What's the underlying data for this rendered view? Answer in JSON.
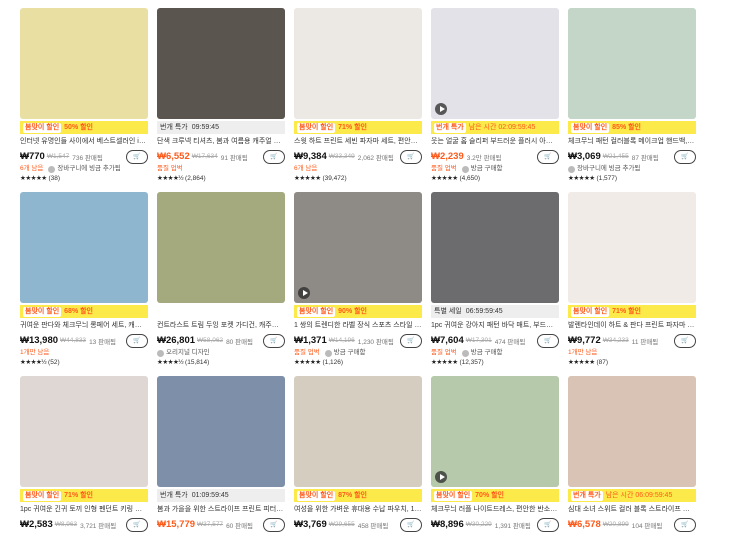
{
  "products": [
    {
      "image": "Yellow phone case",
      "bg": "#e9dfa3",
      "promo": {
        "style": "yellow",
        "tag": "봄맞이 할인",
        "discount": "50% 할인"
      },
      "title": "인터넷 유명인들 사이에서 베스트셀러인 iPh…",
      "price": "₩770",
      "orig": "₩1,547",
      "sold": "736 판매됨",
      "badge": "6개 남음",
      "seller": "장바구니에 빙금 추가됨",
      "rating": "(38)",
      "stars": "★★★★★",
      "hot": false,
      "video": false
    },
    {
      "image": "Girl in white t-shirt mirror selfie",
      "bg": "#5b5550",
      "promo": {
        "style": "gray",
        "label": "번개 특가",
        "timer": "09:59:45",
        "red": false
      },
      "title": "단색 크루넥 티셔츠, 봄과 여름용 캐주얼 반…",
      "price": "₩6,552",
      "orig": "₩17,634",
      "sold": "91 판매됨",
      "badge": "품질 업벅",
      "seller": "",
      "rating": "(2,864)",
      "stars": "★★★★½",
      "hot": true,
      "video": false
    },
    {
      "image": "Polka dot pajama set",
      "bg": "#ece9e4",
      "promo": {
        "style": "yellow",
        "tag": "봄맞이 할인",
        "discount": "71% 할인"
      },
      "title": "스윗 하트 프린트 세빈 파자마 세트, 편안한 …",
      "price": "₩9,384",
      "orig": "₩33,349",
      "sold": "2,062 판매됨",
      "badge": "6개 남음",
      "seller": "",
      "rating": "(39,472)",
      "stars": "★★★★★",
      "hot": false,
      "video": false
    },
    {
      "image": "Smiley slippers",
      "bg": "#e2e2e8",
      "promo": {
        "style": "yellow",
        "tag": "번개 특가",
        "timer": "남은 시간 02:09:59:45",
        "red": true
      },
      "title": "웃는 얼굴 홈 슬리퍼 부드러운 플러시 아늑한 …",
      "price": "₩2,239",
      "orig": "",
      "sold": "3.2만 판매됨",
      "badge": "품질 업벅",
      "seller": "방금 구매함",
      "rating": "(4,650)",
      "stars": "★★★★★",
      "hot": true,
      "video": true
    },
    {
      "image": "Pink plaid makeup bag",
      "bg": "#c3d6c8",
      "promo": {
        "style": "yellow",
        "tag": "봄맞이 할인",
        "discount": "85% 할인"
      },
      "title": "체크무늬 패턴 컬러블록 메이크업 핸드백, 지…",
      "price": "₩3,069",
      "orig": "₩21,455",
      "sold": "87 판매됨",
      "badge": "",
      "seller": "장바구니에 빙금 추가됨",
      "rating": "(1,577)",
      "stars": "★★★★★",
      "hot": false,
      "video": false
    },
    {
      "image": "Striped pajama cardigan",
      "bg": "#8fb6cf",
      "promo": {
        "style": "yellow",
        "tag": "봄맞이 할인",
        "discount": "68% 할인"
      },
      "title": "귀여운 판다와 체크무늬 롱페어 세트, 캐주얼…",
      "price": "₩13,980",
      "orig": "₩44,833",
      "sold": "13 판매됨",
      "badge": "1개만 남음",
      "seller": "",
      "rating": "(52)",
      "stars": "★★★★½",
      "hot": false,
      "video": false
    },
    {
      "image": "Green knit cardigan",
      "bg": "#a4aa7e",
      "promo": {
        "style": "none"
      },
      "title": "컨트라스트 트림 두잉 포켓 가디건, 캐주얼 롱…",
      "price": "₩26,801",
      "orig": "₩58,062",
      "sold": "80 판매됨",
      "badge": "",
      "seller": "오리지널 디자인",
      "rating": "(15,814)",
      "stars": "★★★★½",
      "hot": false,
      "video": false
    },
    {
      "image": "Green bear socks",
      "bg": "#8e8a86",
      "promo": {
        "style": "yellow",
        "tag": "봄맞이 할인",
        "discount": "90% 할인"
      },
      "title": "1 쌍의 트렌디한 라벨 장식 스포츠 스타일 …",
      "price": "₩1,371",
      "orig": "₩14,196",
      "sold": "1,230 판매됨",
      "badge": "품질 업벅",
      "seller": "방금 구매함",
      "rating": "(1,126)",
      "stars": "★★★★★",
      "hot": false,
      "video": true
    },
    {
      "image": "Dog bath mat",
      "bg": "#6c6c6f",
      "promo": {
        "style": "gray",
        "label": "특별 세일",
        "timer": "06:59:59:45",
        "red": false
      },
      "title": "1pc 귀여운 강아지 패턴 바닥 매트, 부드러운…",
      "price": "₩7,604",
      "orig": "₩17,301",
      "sold": "474 판매됨",
      "badge": "품질 업벅",
      "seller": "방금 구매함",
      "rating": "(12,357)",
      "stars": "★★★★★",
      "hot": false,
      "video": false
    },
    {
      "image": "Heart print pajama",
      "bg": "#f0ebe6",
      "promo": {
        "style": "yellow",
        "tag": "봄맞이 할인",
        "discount": "71% 할인"
      },
      "title": "발렌타인데이 하트 & 판다 프린트 파자마 세…",
      "price": "₩9,772",
      "orig": "₩34,233",
      "sold": "11 판매됨",
      "badge": "1개만 남음",
      "seller": "",
      "rating": "(87)",
      "stars": "★★★★★",
      "hot": false,
      "video": false
    },
    {
      "image": "Plush bunny doll",
      "bg": "#dfd7d3",
      "promo": {
        "style": "yellow",
        "tag": "봄맞이 할인",
        "discount": "71% 할인"
      },
      "title": "1pc 귀여운 긴귀 토끼 인형 펜던트 키링 소녀…",
      "price": "₩2,583",
      "orig": "₩8,963",
      "sold": "3,721 판매됨",
      "badge": "",
      "seller": "",
      "rating": "",
      "stars": "",
      "hot": false,
      "video": false
    },
    {
      "image": "Blue collar blouse",
      "bg": "#7e8faa",
      "promo": {
        "style": "gray",
        "label": "번개 특가",
        "timer": "01:09:59:45",
        "red": false
      },
      "title": "봄과 가을을 위한 스트라이프 프린트 피터팬 …",
      "price": "₩15,779",
      "orig": "₩37,577",
      "sold": "60 판매됨",
      "badge": "",
      "seller": "",
      "rating": "",
      "stars": "",
      "hot": true,
      "video": false
    },
    {
      "image": "Teddy bear seat cushion",
      "bg": "#d6cdc1",
      "promo": {
        "style": "yellow",
        "tag": "봄맞이 할인",
        "discount": "87% 할인"
      },
      "title": "여성을 위한 가벼운 휴대용 수납 파우치, 1개…",
      "price": "₩3,769",
      "orig": "₩29,655",
      "sold": "458 판매됨",
      "badge": "",
      "seller": "",
      "rating": "",
      "stars": "",
      "hot": false,
      "video": false
    },
    {
      "image": "Green gingham dress",
      "bg": "#b6c9aa",
      "promo": {
        "style": "yellow",
        "tag": "봄맞이 할인",
        "discount": "70% 할인"
      },
      "title": "체크무늬 러플 나이트드레스, 편안한 반소매 …",
      "price": "₩8,896",
      "orig": "₩30,229",
      "sold": "1,391 판매됨",
      "badge": "",
      "seller": "",
      "rating": "",
      "stars": "",
      "hot": false,
      "video": true
    },
    {
      "image": "Red striped knit top",
      "bg": "#d9c3b4",
      "promo": {
        "style": "yellow",
        "tag": "번개 특가",
        "timer": "남은 시간 06:09:59:45",
        "red": true
      },
      "title": "심대 소녀 스위트 컬러 블록 스트라이프 탱크…",
      "price": "₩6,578",
      "orig": "₩20,899",
      "sold": "104 판매됨",
      "badge": "",
      "seller": "",
      "rating": "",
      "stars": "",
      "hot": true,
      "video": false
    }
  ]
}
